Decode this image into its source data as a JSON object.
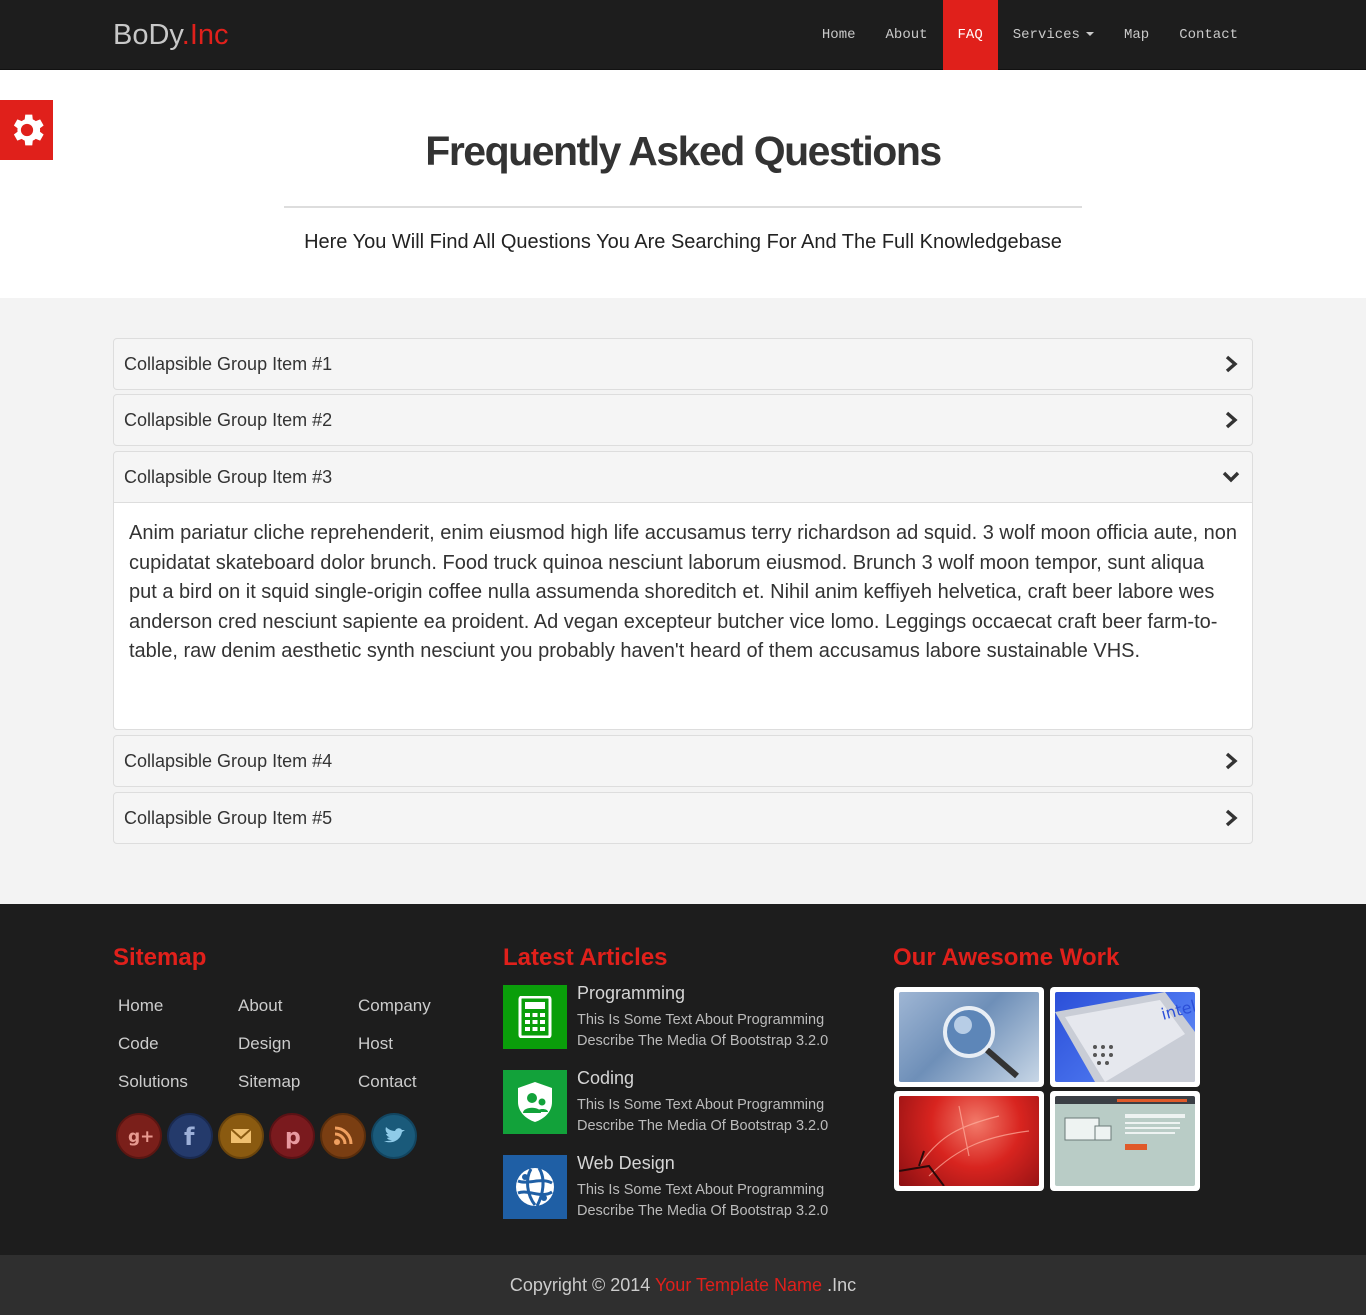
{
  "brand": {
    "part1": "BoDy",
    "part2": ".Inc"
  },
  "nav": {
    "items": [
      {
        "label": "Home"
      },
      {
        "label": "About"
      },
      {
        "label": "FAQ"
      },
      {
        "label": "Services"
      },
      {
        "label": "Map"
      },
      {
        "label": "Contact"
      }
    ],
    "active": "FAQ"
  },
  "settings": {
    "icon": "gear-icon"
  },
  "header": {
    "title": "Frequently Asked Questions",
    "subtitle": "Here You Will Find All Questions You Are Searching For And The Full Knowledgebase"
  },
  "faq": {
    "items": [
      {
        "title": "Collapsible Group Item #1",
        "icon": "chevron-right-icon"
      },
      {
        "title": "Collapsible Group Item #2",
        "icon": "chevron-right-icon"
      },
      {
        "title": "Collapsible Group Item #3",
        "icon": "chevron-down-icon",
        "body": "Anim pariatur cliche reprehenderit, enim eiusmod high life accusamus terry richardson ad squid. 3 wolf moon officia aute, non cupidatat skateboard dolor brunch. Food truck quinoa nesciunt laborum eiusmod. Brunch 3 wolf moon tempor, sunt aliqua put a bird on it squid single-origin coffee nulla assumenda shoreditch et. Nihil anim keffiyeh helvetica, craft beer labore wes anderson cred nesciunt sapiente ea proident. Ad vegan excepteur butcher vice lomo. Leggings occaecat craft beer farm-to-table, raw denim aesthetic synth nesciunt you probably haven't heard of them accusamus labore sustainable VHS."
      },
      {
        "title": "Collapsible Group Item #4",
        "icon": "chevron-right-icon"
      },
      {
        "title": "Collapsible Group Item #5",
        "icon": "chevron-right-icon"
      }
    ]
  },
  "footer": {
    "sitemap": {
      "heading": "Sitemap",
      "links": [
        "Home",
        "About",
        "Company",
        "Code",
        "Design",
        "Host",
        "Solutions",
        "Sitemap",
        "Contact"
      ],
      "social": [
        "google-plus-icon",
        "facebook-icon",
        "email-icon",
        "pinterest-icon",
        "rss-icon",
        "twitter-icon"
      ]
    },
    "articles": {
      "heading": "Latest Articles",
      "items": [
        {
          "title": "Programming",
          "text": "This Is Some Text About Programming Describe The Media Of Bootstrap 3.2.0",
          "icon": "calculator-icon",
          "color": "#0a9e0a"
        },
        {
          "title": "Coding",
          "text": "This Is Some Text About Programming Describe The Media Of Bootstrap 3.2.0",
          "icon": "shield-user-icon",
          "color": "#12a23a"
        },
        {
          "title": "Web Design",
          "text": "This Is Some Text About Programming Describe The Media Of Bootstrap 3.2.0",
          "icon": "globe-icon",
          "color": "#1f5fa5"
        }
      ]
    },
    "work": {
      "heading": "Our Awesome Work"
    },
    "copyright": {
      "prefix": "Copyright © 2014",
      "name": "Your Template Name",
      "suffix": ".Inc"
    }
  },
  "colors": {
    "accent": "#e0201b",
    "navbar": "#1d1d1d",
    "footer": "#1d1d1d",
    "bottom_bar": "#2f2f2f",
    "faq_bg": "#f3f3f3"
  }
}
